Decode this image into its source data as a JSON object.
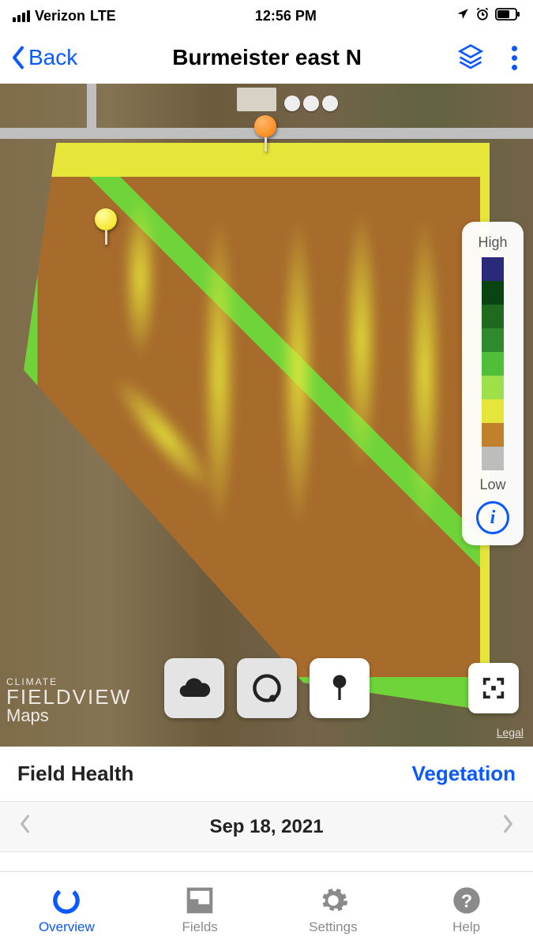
{
  "status": {
    "carrier": "Verizon",
    "network": "LTE",
    "time": "12:56 PM"
  },
  "nav": {
    "back": "Back",
    "title": "Burmeister east N"
  },
  "legend": {
    "high": "High",
    "low": "Low"
  },
  "map": {
    "attribution_brand": "CLIMATE",
    "attribution_product": "FIELDVIEW",
    "map_provider": "Maps",
    "legal": "Legal"
  },
  "section": {
    "title": "Field Health",
    "mode": "Vegetation"
  },
  "date": {
    "current": "Sep 18, 2021"
  },
  "tabs": {
    "overview": "Overview",
    "fields": "Fields",
    "settings": "Settings",
    "help": "Help"
  }
}
